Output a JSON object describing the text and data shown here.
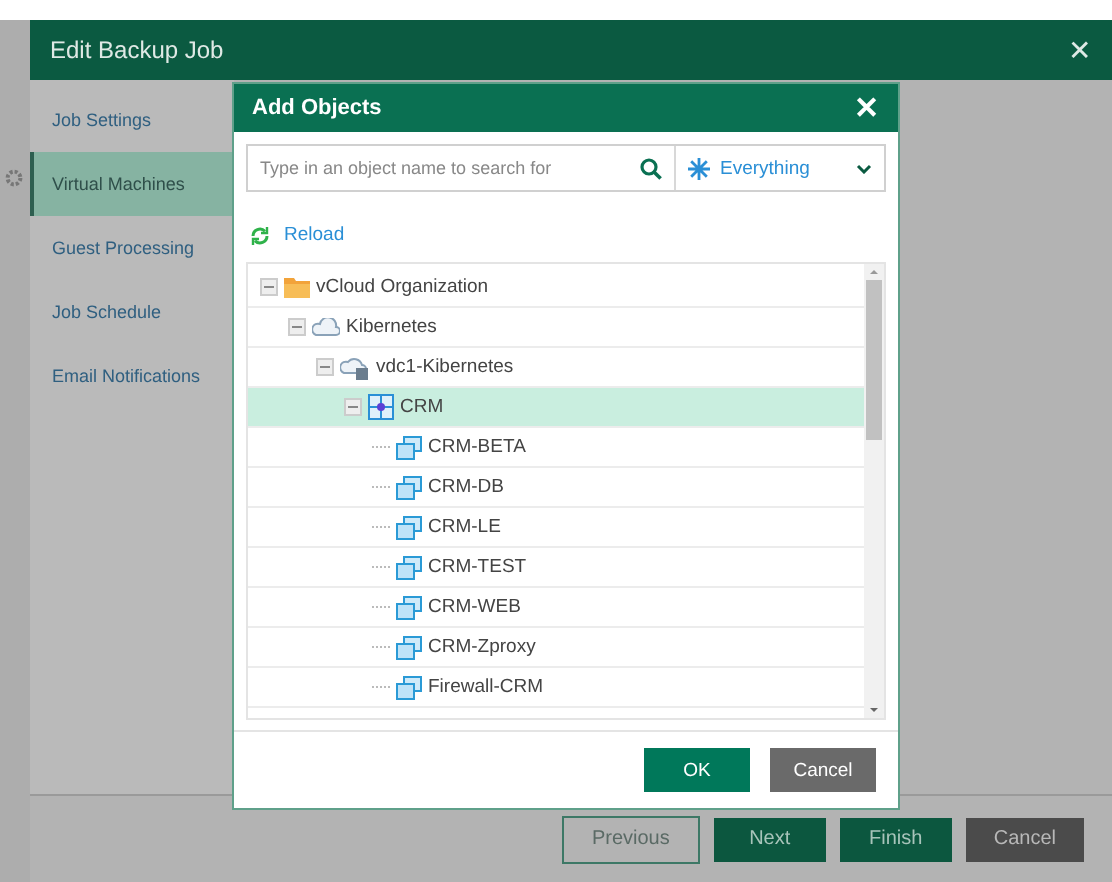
{
  "window": {
    "title": "Edit Backup Job",
    "close": "✕"
  },
  "nav": [
    {
      "label": "Job Settings",
      "selected": false
    },
    {
      "label": "Virtual Machines",
      "selected": true
    },
    {
      "label": "Guest Processing",
      "selected": false
    },
    {
      "label": "Job Schedule",
      "selected": false
    },
    {
      "label": "Email Notifications",
      "selected": false
    }
  ],
  "footer_buttons": [
    {
      "label": "Previous",
      "kind": "outline"
    },
    {
      "label": "Next",
      "kind": "primary"
    },
    {
      "label": "Finish",
      "kind": "primary"
    },
    {
      "label": "Cancel",
      "kind": "secondary"
    }
  ],
  "dialog": {
    "title": "Add Objects",
    "close": "✕",
    "search": {
      "placeholder": "Type in an object name to search for"
    },
    "filter": {
      "value": "Everything"
    },
    "reload": "Reload",
    "tree": [
      {
        "label": "vCloud Organization",
        "kind": "folder",
        "expanded": true,
        "selected": false,
        "children": [
          {
            "label": "Kibernetes",
            "kind": "cloud",
            "expanded": true,
            "selected": false,
            "children": [
              {
                "label": "vdc1-Kibernetes",
                "kind": "vdc",
                "expanded": true,
                "selected": false,
                "children": [
                  {
                    "label": "CRM",
                    "kind": "vapp",
                    "expanded": true,
                    "selected": true,
                    "children": [
                      {
                        "label": "CRM-BETA",
                        "kind": "vm",
                        "selected": false
                      },
                      {
                        "label": "CRM-DB",
                        "kind": "vm",
                        "selected": false
                      },
                      {
                        "label": "CRM-LE",
                        "kind": "vm",
                        "selected": false
                      },
                      {
                        "label": "CRM-TEST",
                        "kind": "vm",
                        "selected": false
                      },
                      {
                        "label": "CRM-WEB",
                        "kind": "vm",
                        "selected": false
                      },
                      {
                        "label": "CRM-Zproxy",
                        "kind": "vm",
                        "selected": false
                      },
                      {
                        "label": "Firewall-CRM",
                        "kind": "vm",
                        "selected": false
                      }
                    ]
                  }
                ]
              }
            ]
          }
        ]
      }
    ],
    "buttons": [
      {
        "label": "OK",
        "kind": "primary"
      },
      {
        "label": "Cancel",
        "kind": "secondary"
      }
    ]
  }
}
